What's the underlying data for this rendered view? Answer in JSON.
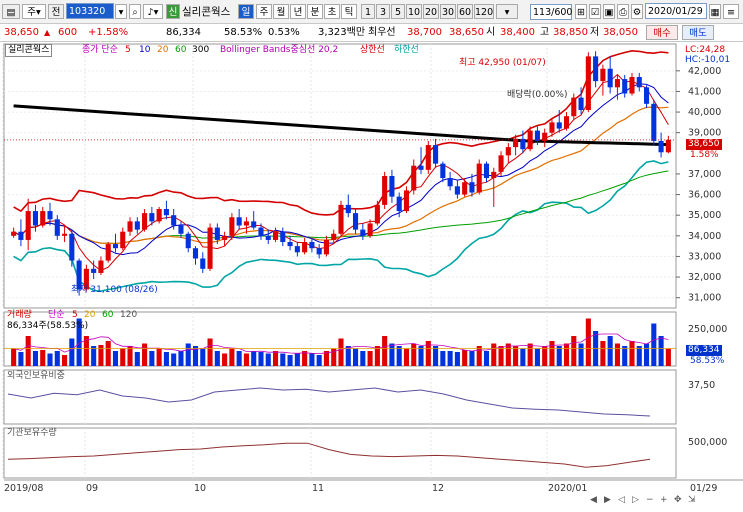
{
  "toolbar": {
    "code": "103320",
    "name": "실리콘웍스",
    "badge": "신",
    "period_buttons": [
      "일",
      "주",
      "월",
      "년",
      "분",
      "초",
      "틱"
    ],
    "active_period": "일",
    "interval_buttons": [
      "1",
      "3",
      "5",
      "10",
      "20",
      "30",
      "60",
      "120"
    ],
    "count": "113/600",
    "date": "2020/01/29",
    "sell_label": "매수"
  },
  "quote": {
    "price": "38,650",
    "change": "600",
    "change_pct": "+1.58%",
    "volume": "86,334",
    "vol_ratio": "58.53%",
    "turnover": "0.53%",
    "amount": "3,323백만",
    "pref_label": "최우선",
    "pref_price": "38,700",
    "pref_price2": "38,650",
    "open_label": "시",
    "open": "38,400",
    "high_label": "고",
    "high": "38,850",
    "low_label": "저",
    "low": "38,050",
    "sell_label": "매도"
  },
  "indicators": {
    "price_name": "실리콘웍스",
    "ma_label": "종가 단순",
    "ma_periods": [
      "5",
      "10",
      "20",
      "60",
      "300"
    ],
    "bb_label": "Bollinger Bands중심선 20,2",
    "bb_upper": "상한선",
    "bb_lower": "하한선",
    "lc": "LC:24,28",
    "hc": "HC:-10,01",
    "max_label": "최고 42,950 (01/07)",
    "min_label": "최저 31,100 (08/26)",
    "div_label": "배당락(0.00%)",
    "last_price": "38,650",
    "last_pct": "1.58%",
    "volume_name": "거래량",
    "volume_ma_label": "단순",
    "volume_ma_periods": [
      "5",
      "20",
      "60",
      "120"
    ],
    "volume_readout": "86,334주(58.53%)",
    "volume_last": "86,334",
    "volume_last_pct": "58.53%",
    "foreign_name": "외국인보유비중",
    "inst_name": "기관보유수량"
  },
  "chart_data": {
    "type": "candlestick",
    "y_ticks": [
      "42,000",
      "41,000",
      "40,000",
      "39,000",
      "37,000",
      "36,000",
      "35,000",
      "34,000",
      "33,000",
      "32,000",
      "31,000"
    ],
    "y_range": [
      30500,
      43300
    ],
    "volume_ticks": [
      "250,000"
    ],
    "foreign_ticks": [
      "37,50"
    ],
    "inst_ticks": [
      "500,000"
    ],
    "x_labels": [
      "2019/08",
      "09",
      "10",
      "11",
      "12",
      "2020/01",
      "01/29"
    ],
    "candles": [
      [
        34000,
        34400,
        33900,
        34200
      ],
      [
        34200,
        34800,
        33500,
        33800
      ],
      [
        33800,
        35800,
        33300,
        35200
      ],
      [
        35200,
        35500,
        34200,
        34500
      ],
      [
        34500,
        35400,
        34400,
        35200
      ],
      [
        35200,
        35600,
        34500,
        34800
      ],
      [
        34800,
        35000,
        33800,
        34000
      ],
      [
        34000,
        34500,
        33700,
        34100
      ],
      [
        34100,
        34300,
        32500,
        32800
      ],
      [
        32800,
        32900,
        31100,
        31400
      ],
      [
        31400,
        32600,
        31300,
        32400
      ],
      [
        32400,
        32800,
        31900,
        32200
      ],
      [
        32200,
        33000,
        32100,
        32800
      ],
      [
        32800,
        33700,
        32700,
        33600
      ],
      [
        33600,
        34100,
        33200,
        33400
      ],
      [
        33400,
        34400,
        33300,
        34200
      ],
      [
        34200,
        34900,
        34000,
        34700
      ],
      [
        34700,
        34900,
        34100,
        34300
      ],
      [
        34300,
        35300,
        34200,
        35100
      ],
      [
        35100,
        35400,
        34500,
        34700
      ],
      [
        34700,
        35400,
        34600,
        35300
      ],
      [
        35300,
        35700,
        34800,
        35000
      ],
      [
        35000,
        35300,
        34300,
        34500
      ],
      [
        34500,
        34700,
        33900,
        34100
      ],
      [
        34100,
        34200,
        33200,
        33400
      ],
      [
        33400,
        33500,
        32600,
        32900
      ],
      [
        32900,
        33200,
        32200,
        32400
      ],
      [
        32400,
        34600,
        32300,
        34400
      ],
      [
        34400,
        34600,
        33600,
        33800
      ],
      [
        33800,
        34200,
        33500,
        34000
      ],
      [
        34000,
        35100,
        33800,
        34900
      ],
      [
        34900,
        35300,
        34300,
        34500
      ],
      [
        34500,
        34900,
        34100,
        34700
      ],
      [
        34700,
        35200,
        34300,
        34400
      ],
      [
        34400,
        34600,
        33800,
        34000
      ],
      [
        34000,
        34300,
        33600,
        33800
      ],
      [
        33800,
        34400,
        33700,
        34200
      ],
      [
        34200,
        34400,
        33500,
        33700
      ],
      [
        33700,
        34000,
        33300,
        33500
      ],
      [
        33500,
        33700,
        33000,
        33200
      ],
      [
        33200,
        33900,
        33100,
        33700
      ],
      [
        33700,
        33900,
        33200,
        33400
      ],
      [
        33400,
        33600,
        32900,
        33100
      ],
      [
        33100,
        34000,
        33000,
        33800
      ],
      [
        33800,
        34300,
        33600,
        34100
      ],
      [
        34100,
        35700,
        34000,
        35500
      ],
      [
        35500,
        36000,
        34900,
        35100
      ],
      [
        35100,
        35300,
        34100,
        34300
      ],
      [
        34300,
        34600,
        33800,
        34000
      ],
      [
        34000,
        34800,
        33900,
        34600
      ],
      [
        34600,
        35700,
        34500,
        35500
      ],
      [
        35500,
        37100,
        35300,
        36900
      ],
      [
        36900,
        37200,
        35600,
        35900
      ],
      [
        35900,
        36100,
        34900,
        35200
      ],
      [
        35200,
        36400,
        35100,
        36200
      ],
      [
        36200,
        37700,
        36000,
        37400
      ],
      [
        37400,
        38300,
        37000,
        37200
      ],
      [
        37200,
        38600,
        37000,
        38400
      ],
      [
        38400,
        38700,
        37300,
        37500
      ],
      [
        37500,
        37600,
        36600,
        36800
      ],
      [
        36800,
        37100,
        36200,
        36400
      ],
      [
        36400,
        36700,
        35800,
        36000
      ],
      [
        36000,
        36800,
        35900,
        36600
      ],
      [
        36600,
        37000,
        35900,
        36100
      ],
      [
        36100,
        37700,
        36000,
        37500
      ],
      [
        37500,
        37600,
        36600,
        36800
      ],
      [
        36800,
        37300,
        35400,
        37100
      ],
      [
        37100,
        38100,
        36900,
        37900
      ],
      [
        37900,
        38500,
        37500,
        38300
      ],
      [
        38300,
        38900,
        37900,
        38700
      ],
      [
        38700,
        39100,
        38000,
        38200
      ],
      [
        38200,
        39300,
        38100,
        39100
      ],
      [
        39100,
        39300,
        38400,
        38600
      ],
      [
        38600,
        39200,
        38300,
        39000
      ],
      [
        39000,
        39700,
        38800,
        39500
      ],
      [
        39500,
        40100,
        39000,
        39200
      ],
      [
        39200,
        40000,
        39100,
        39800
      ],
      [
        39800,
        40900,
        39600,
        40700
      ],
      [
        40700,
        41200,
        39900,
        40100
      ],
      [
        40100,
        42900,
        40000,
        42700
      ],
      [
        42700,
        42950,
        41200,
        41500
      ],
      [
        41500,
        42300,
        40800,
        42100
      ],
      [
        42100,
        42700,
        40900,
        41200
      ],
      [
        41200,
        41800,
        40600,
        41600
      ],
      [
        41600,
        41800,
        40700,
        40900
      ],
      [
        40900,
        41900,
        40800,
        41700
      ],
      [
        41700,
        41900,
        41000,
        41200
      ],
      [
        41200,
        41300,
        40200,
        40400
      ],
      [
        40400,
        40600,
        38400,
        38600
      ],
      [
        38600,
        39000,
        37800,
        38050
      ],
      [
        38050,
        38850,
        38000,
        38650
      ]
    ],
    "volume_levels": [
      0.35,
      0.28,
      0.6,
      0.3,
      0.32,
      0.25,
      0.3,
      0.22,
      0.55,
      0.95,
      0.6,
      0.4,
      0.42,
      0.5,
      0.3,
      0.35,
      0.4,
      0.28,
      0.45,
      0.3,
      0.35,
      0.28,
      0.25,
      0.3,
      0.45,
      0.4,
      0.35,
      0.55,
      0.3,
      0.25,
      0.35,
      0.3,
      0.25,
      0.3,
      0.28,
      0.25,
      0.3,
      0.25,
      0.22,
      0.25,
      0.3,
      0.25,
      0.22,
      0.3,
      0.35,
      0.55,
      0.4,
      0.35,
      0.3,
      0.3,
      0.4,
      0.6,
      0.45,
      0.4,
      0.35,
      0.45,
      0.4,
      0.5,
      0.4,
      0.3,
      0.3,
      0.28,
      0.32,
      0.3,
      0.4,
      0.3,
      0.45,
      0.4,
      0.45,
      0.4,
      0.35,
      0.45,
      0.35,
      0.4,
      0.5,
      0.4,
      0.45,
      0.6,
      0.45,
      0.95,
      0.7,
      0.5,
      0.6,
      0.45,
      0.4,
      0.5,
      0.4,
      0.45,
      0.85,
      0.6,
      0.35
    ],
    "volume_ma_level": 0.35,
    "foreign_levels": [
      0.4,
      0.5,
      0.38,
      0.42,
      0.3,
      0.45,
      0.5,
      0.6,
      0.55,
      0.35,
      0.3,
      0.25,
      0.3,
      0.28,
      0.35,
      0.3,
      0.25,
      0.35,
      0.3,
      0.4,
      0.55,
      0.65,
      0.75,
      0.78,
      0.8,
      0.85,
      0.9,
      0.92,
      0.95
    ],
    "inst_levels": [
      0.4,
      0.42,
      0.45,
      0.48,
      0.5,
      0.55,
      0.6,
      0.65,
      0.7,
      0.72,
      0.78,
      0.82,
      0.85,
      0.9,
      0.9,
      0.7,
      0.55,
      0.5,
      0.48,
      0.5,
      0.52,
      0.5,
      0.45,
      0.4,
      0.35,
      0.3,
      0.25,
      0.15,
      0.2,
      0.3,
      0.4
    ]
  }
}
